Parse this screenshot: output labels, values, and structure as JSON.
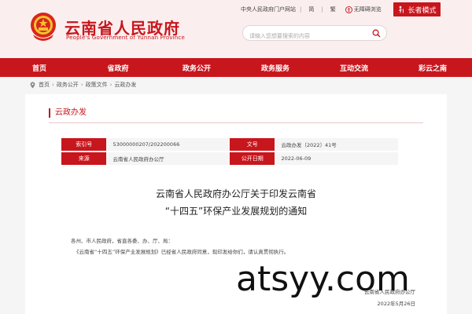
{
  "header": {
    "title": "云南省人民政府",
    "subtitle": "People's Government of Yunnan Province",
    "links": {
      "portal": "中央人民政府门户网站",
      "simplified": "简",
      "traditional": "繁",
      "accessibility": "无障碍浏览"
    },
    "elder_mode": "长者模式",
    "search_placeholder": "请输入您想要搜索的内容"
  },
  "nav": [
    {
      "label": "首页"
    },
    {
      "label": "省政府"
    },
    {
      "label": "政务公开"
    },
    {
      "label": "政务服务"
    },
    {
      "label": "互动交流"
    },
    {
      "label": "彩云之南"
    }
  ],
  "breadcrumb": [
    "首页",
    "政务公开",
    "政策文件",
    "云政办发"
  ],
  "section": {
    "title": "云政办发"
  },
  "info": {
    "index_label": "索引号",
    "index_value": "53000000207/202200066",
    "docno_label": "文号",
    "docno_value": "云政办发〔2022〕41号",
    "source_label": "来源",
    "source_value": "云南省人民政府办公厅",
    "date_label": "公开日期",
    "date_value": "2022-06-09"
  },
  "document": {
    "title_line1": "云南省人民政府办公厅关于印发云南省",
    "title_line2": "“十四五”环保产业发展规划的通知",
    "salutation": "各州、市人民政府，省直各委、办、厅、局：",
    "body": "《云南省“十四五”环保产业发展规划》已经省人民政府同意，现印发给你们，请认真贯彻执行。",
    "sign_org": "云南省人民政府办公厅",
    "sign_date": "2022年5月26日"
  },
  "watermark": "atsyy.com",
  "colors": {
    "brand": "#c8161d",
    "header_bg": "#fbeeee"
  }
}
